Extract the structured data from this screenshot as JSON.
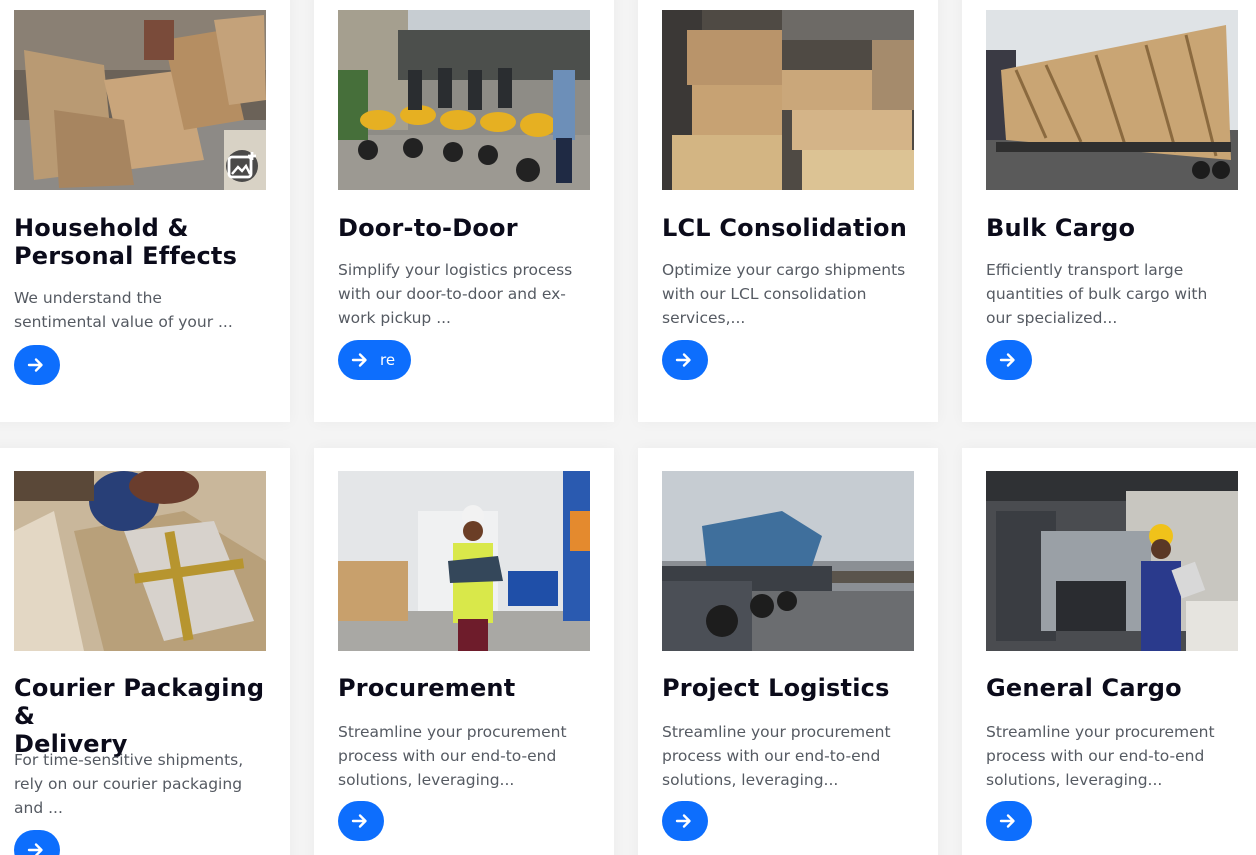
{
  "cards": [
    {
      "title_line1": "Household &",
      "title_line2": "Personal Effects",
      "description": "We understand the sentimental value of your ...",
      "button_label": "",
      "image": "household-boxes-photo"
    },
    {
      "title_line1": "Door-to-Door",
      "title_line2": "",
      "description": "Simplify your logistics process with our door-to-door and ex-work pickup ...",
      "button_label": "re",
      "image": "motorbike-couriers-photo"
    },
    {
      "title_line1": "LCL Consolidation",
      "title_line2": "",
      "description": "Optimize your cargo shipments with our LCL consolidation services,...",
      "button_label": "",
      "image": "stacked-cartons-photo"
    },
    {
      "title_line1": "Bulk Cargo",
      "title_line2": "",
      "description": "Efficiently transport large quantities of bulk cargo with our specialized...",
      "button_label": "",
      "image": "wooden-crate-truck-photo"
    },
    {
      "title_line1": "Courier Packaging &",
      "title_line2": "Delivery",
      "description": "For time-sensitive shipments, rely on our courier packaging and ...",
      "button_label": "",
      "image": "packing-parcel-photo"
    },
    {
      "title_line1": "Procurement",
      "title_line2": "",
      "description": "Streamline your procurement process with our end-to-end solutions, leveraging...",
      "button_label": "",
      "image": "warehouse-worker-photo"
    },
    {
      "title_line1": "Project Logistics",
      "title_line2": "",
      "description": "Streamline your procurement process with our end-to-end solutions, leveraging...",
      "button_label": "",
      "image": "flatbed-truck-photo"
    },
    {
      "title_line1": "General Cargo",
      "title_line2": "",
      "description": "Streamline your procurement process with our end-to-end solutions, leveraging...",
      "button_label": "",
      "image": "forklift-operator-photo"
    }
  ],
  "colors": {
    "accent": "#0d6efd",
    "heading": "#0b0b1a",
    "body_text": "#555a62",
    "page_bg": "#f4f4f4",
    "card_bg": "#ffffff"
  },
  "icons": {
    "button_icon": "arrow-right-icon",
    "image_badge": "add-photo-icon"
  }
}
